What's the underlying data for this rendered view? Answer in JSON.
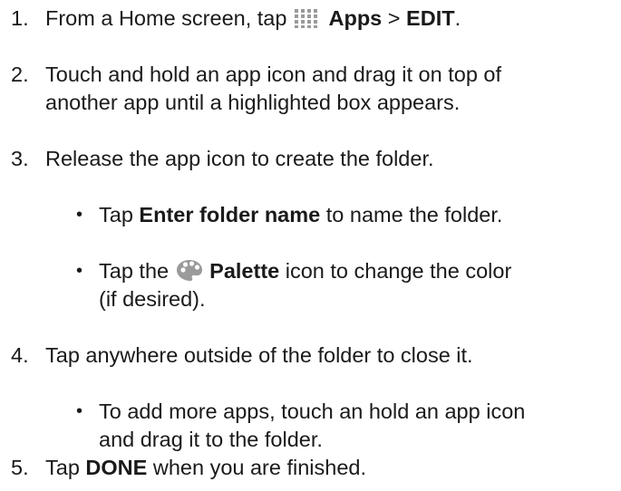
{
  "steps": [
    {
      "num": "1.",
      "parts": {
        "a": "From a Home screen, tap ",
        "b": "Apps",
        "c": " > ",
        "d": "EDIT",
        "e": "."
      },
      "icon": "apps-grid-icon"
    },
    {
      "num": "2.",
      "line1": "Touch and hold an app icon and drag it on top of",
      "line2": "another app until a highlighted box appears."
    },
    {
      "num": "3.",
      "line1": "Release the app icon to create the folder.",
      "subs": [
        {
          "a": "Tap ",
          "b": "Enter folder name",
          "c": " to name the folder."
        },
        {
          "a": "Tap the ",
          "b": "Palette",
          "c": " icon to change the color",
          "line2": "(if desired).",
          "icon": "palette-icon"
        }
      ]
    },
    {
      "num": "4.",
      "line1": "Tap anywhere outside of the folder to close it.",
      "subs": [
        {
          "line1": "To add more apps, touch an hold an app icon",
          "line2": "and drag it to the folder."
        }
      ]
    },
    {
      "num": "5.",
      "parts": {
        "a": "Tap ",
        "b": "DONE",
        "c": " when you are finished."
      }
    }
  ],
  "bullet": "•",
  "colors": {
    "text": "#1a1a1a",
    "icon": "#9a9a9a"
  }
}
